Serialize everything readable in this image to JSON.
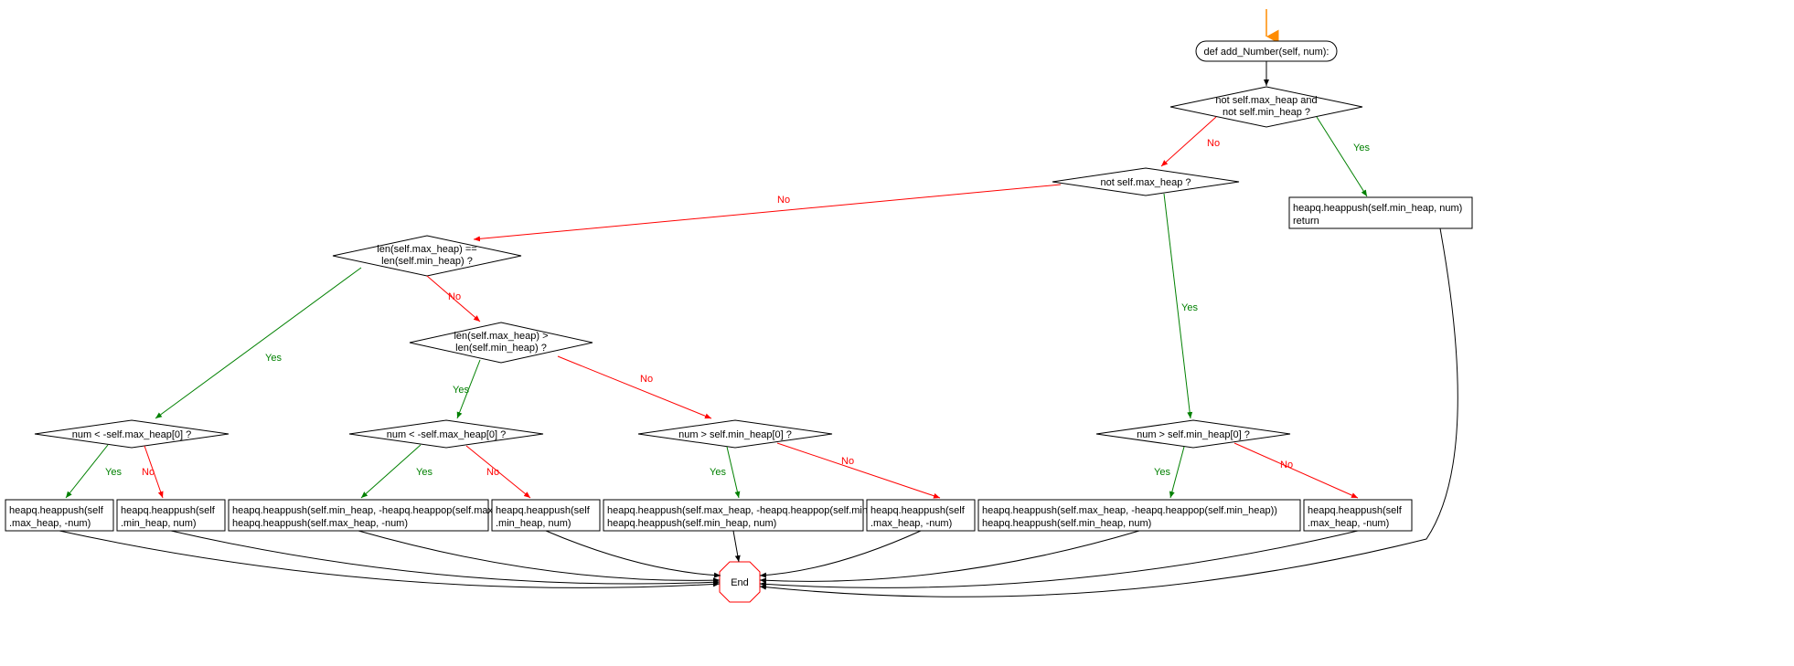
{
  "colors": {
    "yes": "#008000",
    "no": "#ff0000",
    "entry_arrow": "#ff8c00",
    "node_stroke": "#000000",
    "end_stroke": "#ff0000"
  },
  "labels": {
    "yes": "Yes",
    "no": "No"
  },
  "nodes": {
    "start": "def add_Number(self, num):",
    "c1": "not self.max_heap and\nnot self.min_heap ?",
    "a1": "heapq.heappush(self.min_heap, num)\nreturn",
    "c2": "not self.max_heap ?",
    "c3": "len(self.max_heap) ==\nlen(self.min_heap) ?",
    "c4": "len(self.max_heap) >\nlen(self.min_heap) ?",
    "c5": "num < -self.max_heap[0] ?",
    "c6": "num < -self.max_heap[0] ?",
    "c7": "num > self.min_heap[0] ?",
    "c8": "num > self.min_heap[0] ?",
    "b1": "heapq.heappush(self\n.max_heap, -num)",
    "b2": "heapq.heappush(self\n.min_heap, num)",
    "b3": "heapq.heappush(self.min_heap, -heapq.heappop(self.max_heap))\nheapq.heappush(self.max_heap, -num)",
    "b4": "heapq.heappush(self\n.min_heap, num)",
    "b5": "heapq.heappush(self.max_heap, -heapq.heappop(self.min_heap))\nheapq.heappush(self.min_heap, num)",
    "b6": "heapq.heappush(self\n.max_heap, -num)",
    "b7": "heapq.heappush(self.max_heap, -heapq.heappop(self.min_heap))\nheapq.heappush(self.min_heap, num)",
    "b8": "heapq.heappush(self\n.max_heap, -num)",
    "end": "End"
  }
}
